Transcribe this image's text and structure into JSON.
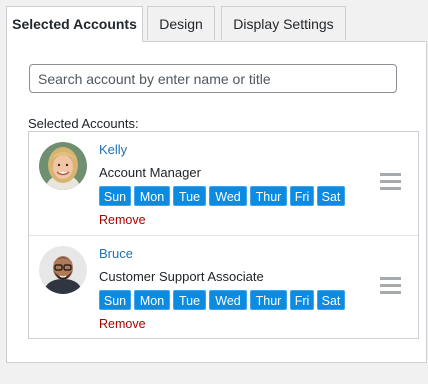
{
  "tabs": [
    {
      "label": "Selected Accounts",
      "active": true
    },
    {
      "label": "Design",
      "active": false
    },
    {
      "label": "Display Settings",
      "active": false
    }
  ],
  "search": {
    "placeholder": "Search account by enter name or title"
  },
  "selected_label": "Selected Accounts:",
  "accounts": [
    {
      "name": "Kelly",
      "title": "Account Manager",
      "remove_label": "Remove",
      "days": [
        "Sun",
        "Mon",
        "Tue",
        "Wed",
        "Thur",
        "Fri",
        "Sat"
      ]
    },
    {
      "name": "Bruce",
      "title": "Customer Support Associate",
      "remove_label": "Remove",
      "days": [
        "Sun",
        "Mon",
        "Tue",
        "Wed",
        "Thur",
        "Fri",
        "Sat"
      ]
    }
  ],
  "colors": {
    "day_bg": "#0c8be3",
    "link": "#2271b1",
    "remove": "#aa0000",
    "handle": "#a7aaad"
  }
}
